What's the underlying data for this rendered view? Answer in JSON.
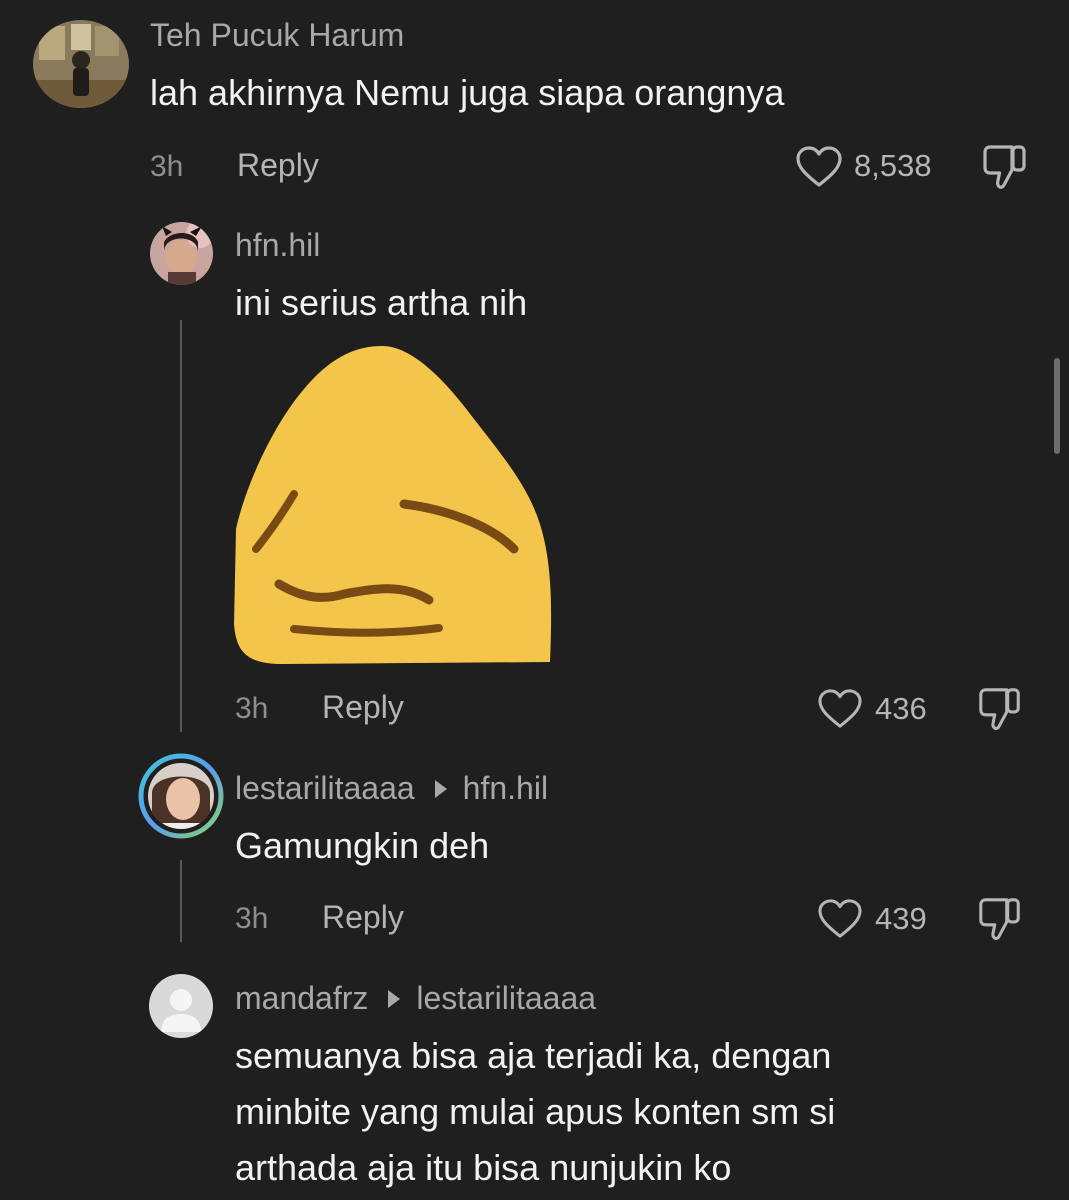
{
  "comments": [
    {
      "username": "Teh Pucuk Harum",
      "text": "lah akhirnya Nemu juga siapa orangnya",
      "time": "3h",
      "reply_label": "Reply",
      "likes": "8,538"
    },
    {
      "username": "hfn.hil",
      "text": "ini serius artha nih",
      "time": "3h",
      "reply_label": "Reply",
      "likes": "436"
    },
    {
      "username": "lestarilitaaaa",
      "reply_to": "hfn.hil",
      "text": "Gamungkin deh",
      "time": "3h",
      "reply_label": "Reply",
      "likes": "439"
    },
    {
      "username": "mandafrz",
      "reply_to": "lestarilitaaaa",
      "text_lines": [
        "semuanya bisa aja terjadi ka, dengan",
        "minbite yang mulai apus konten sm si",
        "arthada aja itu bisa nunjukin ko"
      ]
    }
  ],
  "icons": {
    "like": "heart-outline-icon",
    "dislike": "thumbs-down-outline-icon",
    "reply_arrow": "triangle-right-icon"
  },
  "colors": {
    "background": "#1f1f1f",
    "username": "#a8a8a8",
    "text": "#f2f2f2",
    "emoji_yellow": "#f4c54b",
    "emoji_feature": "#7a4a14",
    "story_ring": "#3ec6d8"
  }
}
